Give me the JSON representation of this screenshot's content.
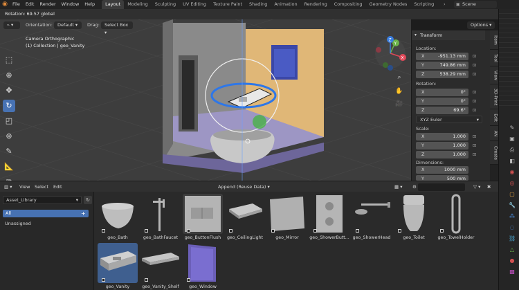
{
  "menu": [
    "File",
    "Edit",
    "Render",
    "Window",
    "Help"
  ],
  "workspaces": [
    "Layout",
    "Modeling",
    "Sculpting",
    "UV Editing",
    "Texture Paint",
    "Shading",
    "Animation",
    "Rendering",
    "Compositing",
    "Geometry Nodes",
    "Scripting"
  ],
  "scene": "Scene",
  "status": "Rotation: 69.57 global",
  "viewport": {
    "orientation_label": "Orientation:",
    "orientation_value": "Default",
    "drag_label": "Drag:",
    "drag_value": "Select Box",
    "options": "Options",
    "view_name": "Camera Orthographic",
    "collection": "(1) Collection | geo_Vanity",
    "gizmo_axes": {
      "x": "X",
      "y": "Y",
      "z": "Z"
    }
  },
  "npanel": {
    "title": "Transform",
    "location_label": "Location:",
    "location": {
      "x": "-951.13 mm",
      "y": "749.86 mm",
      "z": "538.29 mm"
    },
    "rotation_label": "Rotation:",
    "rotation": {
      "x": "0°",
      "y": "0°",
      "z": "69.6°"
    },
    "rotation_mode": "XYZ Euler",
    "scale_label": "Scale:",
    "scale": {
      "x": "1.000",
      "y": "1.000",
      "z": "1.000"
    },
    "dimensions_label": "Dimensions:",
    "dimensions": {
      "x": "1000 mm",
      "y": "500 mm"
    },
    "axis_labels": {
      "x": "X",
      "y": "Y",
      "z": "Z"
    },
    "tabs": [
      "Item",
      "Tool",
      "View",
      "3D-Print",
      "Edit",
      "AN",
      "Create"
    ]
  },
  "asset_browser": {
    "menu": [
      "View",
      "Select",
      "Edit"
    ],
    "import_mode": "Append (Reuse Data)",
    "library": "Asset_Library",
    "catalog_all": "All",
    "catalog_unassigned": "Unassigned",
    "assets": [
      {
        "name": "geo_Bath",
        "selected": false
      },
      {
        "name": "geo_BathFaucet",
        "selected": false
      },
      {
        "name": "geo_ButtonFlush",
        "selected": false
      },
      {
        "name": "geo_CeilingLight",
        "selected": false
      },
      {
        "name": "geo_Mirror",
        "selected": false
      },
      {
        "name": "geo_ShowerButt...",
        "selected": false
      },
      {
        "name": "geo_ShowerHead",
        "selected": false
      },
      {
        "name": "geo_Toilet",
        "selected": false
      },
      {
        "name": "geo_TowelHolder",
        "selected": false
      },
      {
        "name": "geo_Vanity",
        "selected": true
      },
      {
        "name": "geo_Vanity_Shelf",
        "selected": false
      },
      {
        "name": "geo_Window",
        "selected": false
      }
    ]
  },
  "colors": {
    "accent": "#4772b3",
    "wall": "#e0b777",
    "floor": "#9d96c4",
    "gizmo_ring": "#2e77e8"
  }
}
